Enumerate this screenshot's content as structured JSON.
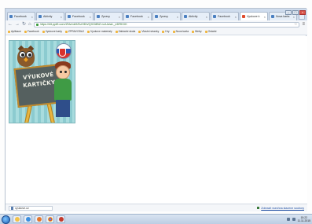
{
  "browser": {
    "tabs": [
      {
        "label": "Facebook",
        "active": false
      },
      {
        "label": "Aktivity",
        "active": false
      },
      {
        "label": "Facebook",
        "active": false
      },
      {
        "label": "Zpravy",
        "active": false
      },
      {
        "label": "Facebook",
        "active": false
      },
      {
        "label": "Zpravy",
        "active": false
      },
      {
        "label": "Aktivity",
        "active": false
      },
      {
        "label": "Facebook",
        "active": false
      },
      {
        "label": "Vyukove k",
        "active": true
      },
      {
        "label": "Nova karta",
        "active": false
      }
    ],
    "url": "https://hlt.pptfl.com/ZNvmkH/DzHDh/QXG8BZ=vzUwwL_eDRKXK",
    "bookmarks": [
      "Aplikace",
      "Facebook",
      "Vyukove karty",
      "ZPRAVODAJ",
      "Vyukove materialy",
      "Zakladni skola",
      "Vlastni stranky",
      "Hry",
      "Nova karta",
      "Weby",
      "Ostatni"
    ],
    "status": {
      "download_item": "vyukove.cz",
      "show_all_downloads": "Zobrazit vsechna stazene soubory"
    }
  },
  "game": {
    "title_line1": "VÝUKOVÉ",
    "title_line2": "KARTIČKY"
  },
  "taskbar": {
    "time": "15:22",
    "date": "11.11.2015"
  },
  "icons": [
    "back-icon",
    "forward-icon",
    "reload-icon",
    "home-icon",
    "lock-icon",
    "star-icon",
    "menu-icon",
    "owl-icon",
    "flag-icon",
    "boy-icon",
    "download-icon",
    "start-icon"
  ],
  "colors": {
    "tabstrip": "#cfdced",
    "game_background": "#9ed5d8",
    "board": "#55605f",
    "taskbar": "#bccde3"
  }
}
